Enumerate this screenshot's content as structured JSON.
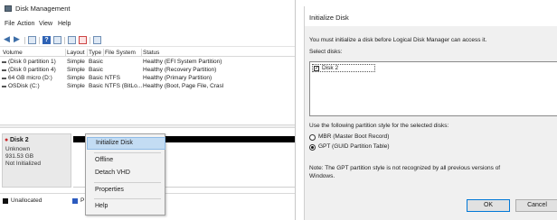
{
  "disk_management": {
    "title": "Disk Management",
    "menu": [
      "File",
      "Action",
      "View",
      "Help"
    ],
    "columns": [
      "Volume",
      "Layout",
      "Type",
      "File System",
      "Status"
    ],
    "volumes": [
      {
        "volume": "(Disk 0 partition 1)",
        "layout": "Simple",
        "type": "Basic",
        "fs": "",
        "status": "Healthy (EFI System Partition)"
      },
      {
        "volume": "(Disk 0 partition 4)",
        "layout": "Simple",
        "type": "Basic",
        "fs": "",
        "status": "Healthy (Recovery Partition)"
      },
      {
        "volume": "64 GB micro (D:)",
        "layout": "Simple",
        "type": "Basic",
        "fs": "NTFS",
        "status": "Healthy (Primary Partition)"
      },
      {
        "volume": "OSDisk (C:)",
        "layout": "Simple",
        "type": "Basic",
        "fs": "NTFS (BitLo...",
        "status": "Healthy (Boot, Page File, Crasl"
      }
    ],
    "disk": {
      "name": "Disk 2",
      "kind": "Unknown",
      "size": "931.53 GB",
      "state": "Not Initialized"
    },
    "legend": [
      "Unallocated",
      "P"
    ],
    "context_menu": [
      "Initialize Disk",
      "Offline",
      "Detach VHD",
      "Properties",
      "Help"
    ]
  },
  "initialize_dialog": {
    "title": "Initialize Disk",
    "intro": "You must initialize a disk before Logical Disk Manager can access it.",
    "select_label": "Select disks:",
    "disks": [
      {
        "label": "Disk 2",
        "checked": true
      }
    ],
    "style_label": "Use the following partition style for the selected disks:",
    "options": [
      {
        "label": "MBR (Master Boot Record)",
        "selected": false
      },
      {
        "label": "GPT (GUID Partition Table)",
        "selected": true
      }
    ],
    "note_line1": "Note: The GPT partition style is not recognized by all previous versions of",
    "note_line2": "Windows.",
    "ok_label": "OK",
    "cancel_label": "Cancel"
  },
  "colors": {
    "selection": "#c3dcf3",
    "unallocated": "#111111",
    "primary": "#2c5bbf",
    "dialog_bg": "#f0f0f0"
  },
  "icons": [
    "disk-management-icon",
    "back-arrow-icon",
    "forward-arrow-icon",
    "properties-icon",
    "help-icon",
    "disk-icon",
    "checkbox-icon",
    "radio-icon"
  ]
}
